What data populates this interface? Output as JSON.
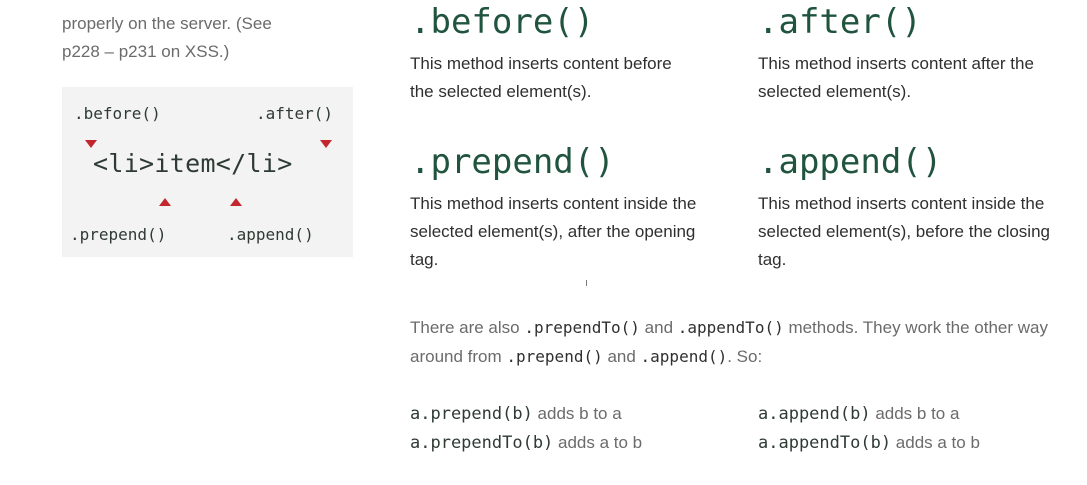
{
  "lead": {
    "line1": "properly on the server. (See",
    "line2": "p228 – p231 on XSS.)"
  },
  "diagram": {
    "before": ".before()",
    "after": ".after()",
    "item": "<li>item</li>",
    "prepend": ".prepend()",
    "append": ".append()"
  },
  "methods": [
    {
      "title": ".before()",
      "desc": "This method inserts content before the selected element(s)."
    },
    {
      "title": ".after()",
      "desc": "This method inserts content after the selected element(s)."
    },
    {
      "title": ".prepend()",
      "desc": "This method inserts content inside the selected element(s), after the opening tag."
    },
    {
      "title": ".append()",
      "desc": "This method inserts content inside the selected element(s), before the closing tag."
    }
  ],
  "note": {
    "p1": "There are also ",
    "code1": ".prependTo()",
    "p2": " and ",
    "code2": ".appendTo()",
    "p3": " methods. They work the other way around from ",
    "code3": ".prepend()",
    "p4": " and ",
    "code4": ".append()",
    "p5": ". So:"
  },
  "examples": [
    {
      "code": "a.prepend(b)",
      "text": " adds b to a"
    },
    {
      "code": "a.prependTo(b)",
      "text": " adds a to b"
    },
    {
      "code": "a.append(b)",
      "text": " adds b to a"
    },
    {
      "code": "a.appendTo(b)",
      "text": " adds a to b"
    }
  ],
  "colors": {
    "heading": "#21543f",
    "marker": "#c2272d",
    "panel": "#f3f3f3"
  }
}
